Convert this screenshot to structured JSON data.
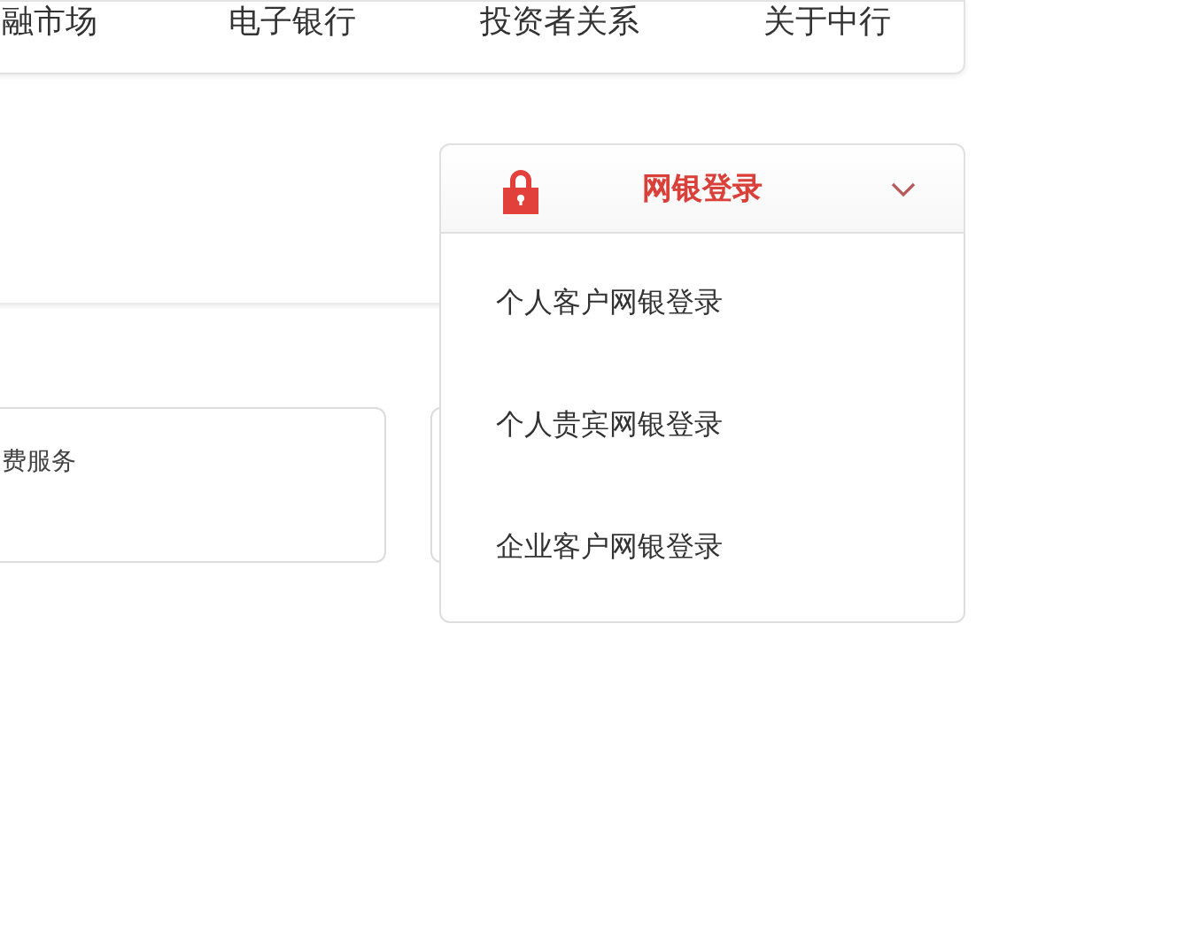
{
  "nav": {
    "items": [
      "融市场",
      "电子银行",
      "投资者关系",
      "关于中行"
    ]
  },
  "service_card": {
    "label": "费服务"
  },
  "login_dropdown": {
    "title": "网银登录",
    "expanded": true,
    "items": [
      "个人客户网银登录",
      "个人贵宾网银登录",
      "企业客户网银登录"
    ]
  }
}
